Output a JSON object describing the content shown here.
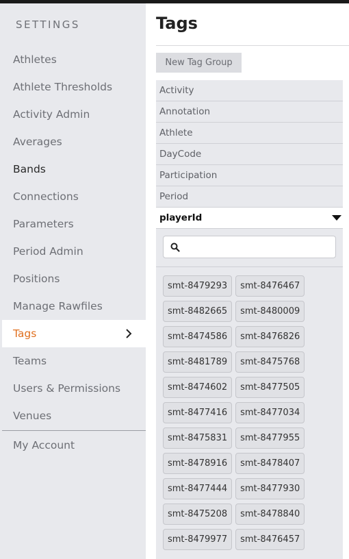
{
  "sidebar": {
    "title": "SETTINGS",
    "items": [
      {
        "label": "Athletes"
      },
      {
        "label": "Athlete Thresholds"
      },
      {
        "label": "Activity Admin"
      },
      {
        "label": "Averages"
      },
      {
        "label": "Bands"
      },
      {
        "label": "Connections"
      },
      {
        "label": "Parameters"
      },
      {
        "label": "Period Admin"
      },
      {
        "label": "Positions"
      },
      {
        "label": "Manage Rawfiles"
      },
      {
        "label": "Tags"
      },
      {
        "label": "Teams"
      },
      {
        "label": "Users & Permissions"
      },
      {
        "label": "Venues"
      }
    ],
    "account_label": "My Account",
    "active_color": "#e0701f"
  },
  "main": {
    "title": "Tags",
    "new_group_label": "New Tag Group",
    "groups": [
      {
        "label": "Activity"
      },
      {
        "label": "Annotation"
      },
      {
        "label": "Athlete"
      },
      {
        "label": "DayCode"
      },
      {
        "label": "Participation"
      },
      {
        "label": "Period"
      }
    ],
    "expanded_group": {
      "label": "playerId",
      "search_placeholder": "",
      "search_value": "",
      "tags": [
        "smt-8479293",
        "smt-8476467",
        "smt-8482665",
        "smt-8480009",
        "smt-8474586",
        "smt-8476826",
        "smt-8481789",
        "smt-8475768",
        "smt-8474602",
        "smt-8477505",
        "smt-8477416",
        "smt-8477034",
        "smt-8475831",
        "smt-8477955",
        "smt-8478916",
        "smt-8478407",
        "smt-8477444",
        "smt-8477930",
        "smt-8475208",
        "smt-8478840",
        "smt-8479977",
        "smt-8476457"
      ]
    }
  }
}
